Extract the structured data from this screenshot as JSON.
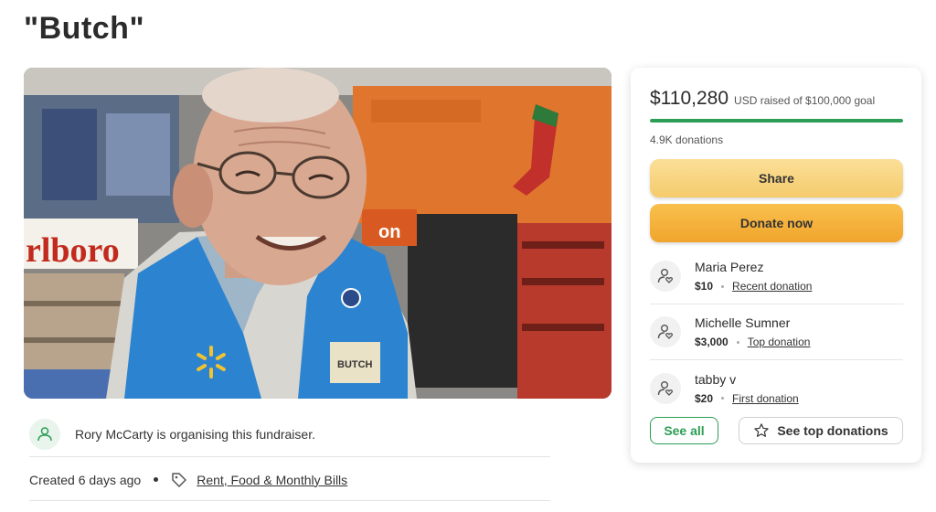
{
  "page": {
    "title": "\"Butch\""
  },
  "hero": {
    "badge_text": "BUTCH",
    "sign_fragment": "rlboro",
    "store_sign": "on"
  },
  "organiser": {
    "text": "Rory McCarty is organising this fundraiser."
  },
  "meta": {
    "created": "Created 6 days ago",
    "category": "Rent, Food & Monthly Bills"
  },
  "donation_card": {
    "amount": "$110,280",
    "goal_text": "USD raised of $100,000 goal",
    "progress_fraction": 1.0,
    "donation_count": "4.9K donations",
    "share_label": "Share",
    "donate_label": "Donate now",
    "donors": [
      {
        "name": "Maria Perez",
        "amount": "$10",
        "type": "Recent donation"
      },
      {
        "name": "Michelle Sumner",
        "amount": "$3,000",
        "type": "Top donation"
      },
      {
        "name": "tabby v",
        "amount": "$20",
        "type": "First donation"
      }
    ],
    "see_all_label": "See all",
    "see_top_label": "See top donations"
  },
  "colors": {
    "accent_green": "#2e9e56",
    "share_button": "#f7d37e",
    "donate_button": "#f4b23c"
  }
}
